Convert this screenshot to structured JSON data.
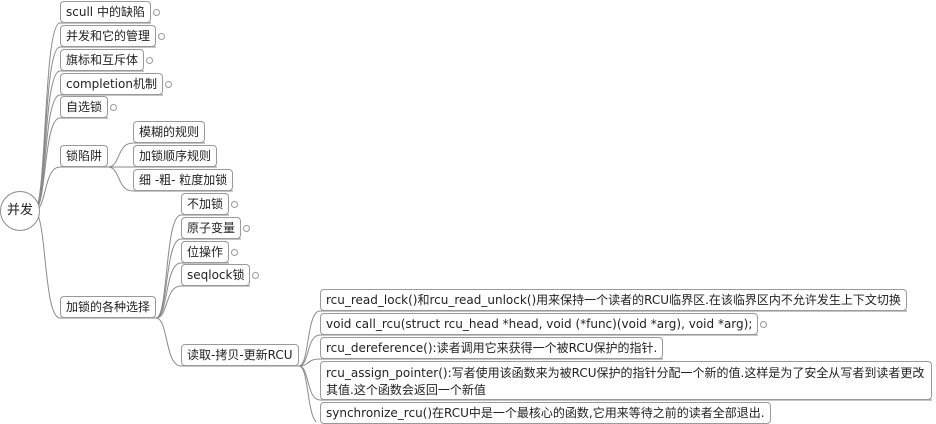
{
  "root": {
    "label": "并发"
  },
  "nodes": {
    "n1": "scull 中的缺陷",
    "n2": "并发和它的管理",
    "n3": "旗标和互斥体",
    "n4": "completion机制",
    "n5": "自选锁",
    "n6": "锁陷阱",
    "n6a": "模糊的规则",
    "n6b": "加锁顺序规则",
    "n6c": "细 -粗- 粒度加锁",
    "n7": "加锁的各种选择",
    "n7a": "不加锁",
    "n7b": "原子变量",
    "n7c": "位操作",
    "n7d": "seqlock锁",
    "n7e": "读取-拷贝-更新RCU",
    "r1": "rcu_read_lock()和rcu_read_unlock()用来保持一个读者的RCU临界区.在该临界区内不允许发生上下文切换",
    "r2": "void call_rcu(struct rcu_head *head, void (*func)(void *arg), void *arg);",
    "r3": "rcu_dereference():读者调用它来获得一个被RCU保护的指针.",
    "r4": "rcu_assign_pointer():写者使用该函数来为被RCU保护的指针分配一个新的值.这样是为了安全从写者到读者更改其值.这个函数会返回一个新值",
    "r5": "synchronize_rcu()在RCU中是一个最核心的函数,它用来等待之前的读者全部退出."
  }
}
